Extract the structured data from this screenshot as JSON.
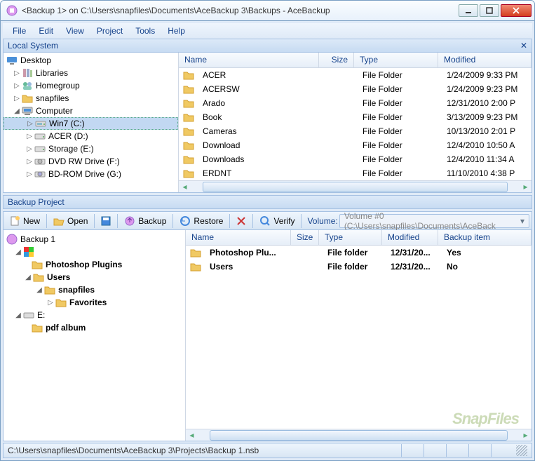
{
  "window": {
    "title": "<Backup 1> on C:\\Users\\snapfiles\\Documents\\AceBackup 3\\Backups - AceBackup"
  },
  "menu": [
    "File",
    "Edit",
    "View",
    "Project",
    "Tools",
    "Help"
  ],
  "local_system": {
    "label": "Local System",
    "tree": {
      "desktop": "Desktop",
      "libraries": "Libraries",
      "homegroup": "Homegroup",
      "snapfiles": "snapfiles",
      "computer": "Computer",
      "win7": "Win7 (C:)",
      "acer": "ACER (D:)",
      "storage": "Storage (E:)",
      "dvd": "DVD RW Drive (F:)",
      "bdrom": "BD-ROM Drive (G:)"
    },
    "columns": {
      "name": "Name",
      "size": "Size",
      "type": "Type",
      "modified": "Modified"
    },
    "files": [
      {
        "name": "ACER",
        "size": "",
        "type": "File Folder",
        "modified": "1/24/2009 9:33 PM"
      },
      {
        "name": "ACERSW",
        "size": "",
        "type": "File Folder",
        "modified": "1/24/2009 9:23 PM"
      },
      {
        "name": "Arado",
        "size": "",
        "type": "File Folder",
        "modified": "12/31/2010 2:00 P"
      },
      {
        "name": "Book",
        "size": "",
        "type": "File Folder",
        "modified": "3/13/2009 9:23 PM"
      },
      {
        "name": "Cameras",
        "size": "",
        "type": "File Folder",
        "modified": "10/13/2010 2:01 P"
      },
      {
        "name": "Download",
        "size": "",
        "type": "File Folder",
        "modified": "12/4/2010 10:50 A"
      },
      {
        "name": "Downloads",
        "size": "",
        "type": "File Folder",
        "modified": "12/4/2010 11:34 A"
      },
      {
        "name": "ERDNT",
        "size": "",
        "type": "File Folder",
        "modified": "11/10/2010 4:38 P"
      }
    ]
  },
  "project": {
    "label": "Backup Project",
    "toolbar": {
      "new": "New",
      "open": "Open",
      "backup": "Backup",
      "restore": "Restore",
      "verify": "Verify",
      "volume_label": "Volume:",
      "volume_value": "Volume #0 (C:\\Users\\snapfiles\\Documents\\AceBack"
    },
    "tree": {
      "root": "Backup 1",
      "cdrive": "",
      "photoshop": "Photoshop Plugins",
      "users": "Users",
      "snapfiles": "snapfiles",
      "favorites": "Favorites",
      "edrive": "E:",
      "pdfalbum": "pdf album"
    },
    "columns": {
      "name": "Name",
      "size": "Size",
      "type": "Type",
      "modified": "Modified",
      "backup_item": "Backup item"
    },
    "files": [
      {
        "name": "Photoshop Plu...",
        "size": "",
        "type": "File folder",
        "modified": "12/31/20...",
        "backup_item": "Yes"
      },
      {
        "name": "Users",
        "size": "",
        "type": "File folder",
        "modified": "12/31/20...",
        "backup_item": "No"
      }
    ]
  },
  "watermark": "SnapFiles",
  "status": {
    "path": "C:\\Users\\snapfiles\\Documents\\AceBackup 3\\Projects\\Backup 1.nsb"
  }
}
